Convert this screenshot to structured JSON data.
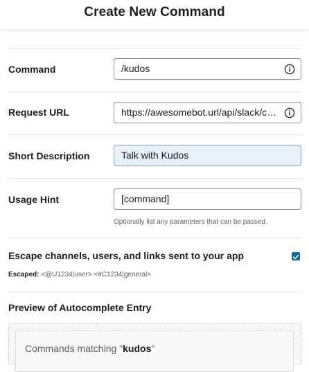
{
  "header": {
    "title": "Create New Command"
  },
  "form": {
    "command": {
      "label": "Command",
      "value": "/kudos"
    },
    "request_url": {
      "label": "Request URL",
      "value": "https://awesomebot.url/api/slack/commands"
    },
    "short_description": {
      "label": "Short Description",
      "value": "Talk with Kudos"
    },
    "usage_hint": {
      "label": "Usage Hint",
      "value": "[command]",
      "helper": "Optionally list any parameters that can be passed."
    },
    "escape": {
      "label": "Escape channels, users, and links sent to your app",
      "checked": true,
      "example_prefix": "Escaped:",
      "example_value": "<@U1234|user> <#C1234|general>"
    }
  },
  "preview": {
    "label": "Preview of Autocomplete Entry",
    "matching_prefix": "Commands matching \"",
    "matching_term": "kudos",
    "matching_suffix": "\""
  },
  "colors": {
    "accent": "#1264a3",
    "highlight_field": "#e8f1fb"
  },
  "icons": {
    "info": "info-circle-icon",
    "checkbox": "checkmark-icon"
  }
}
